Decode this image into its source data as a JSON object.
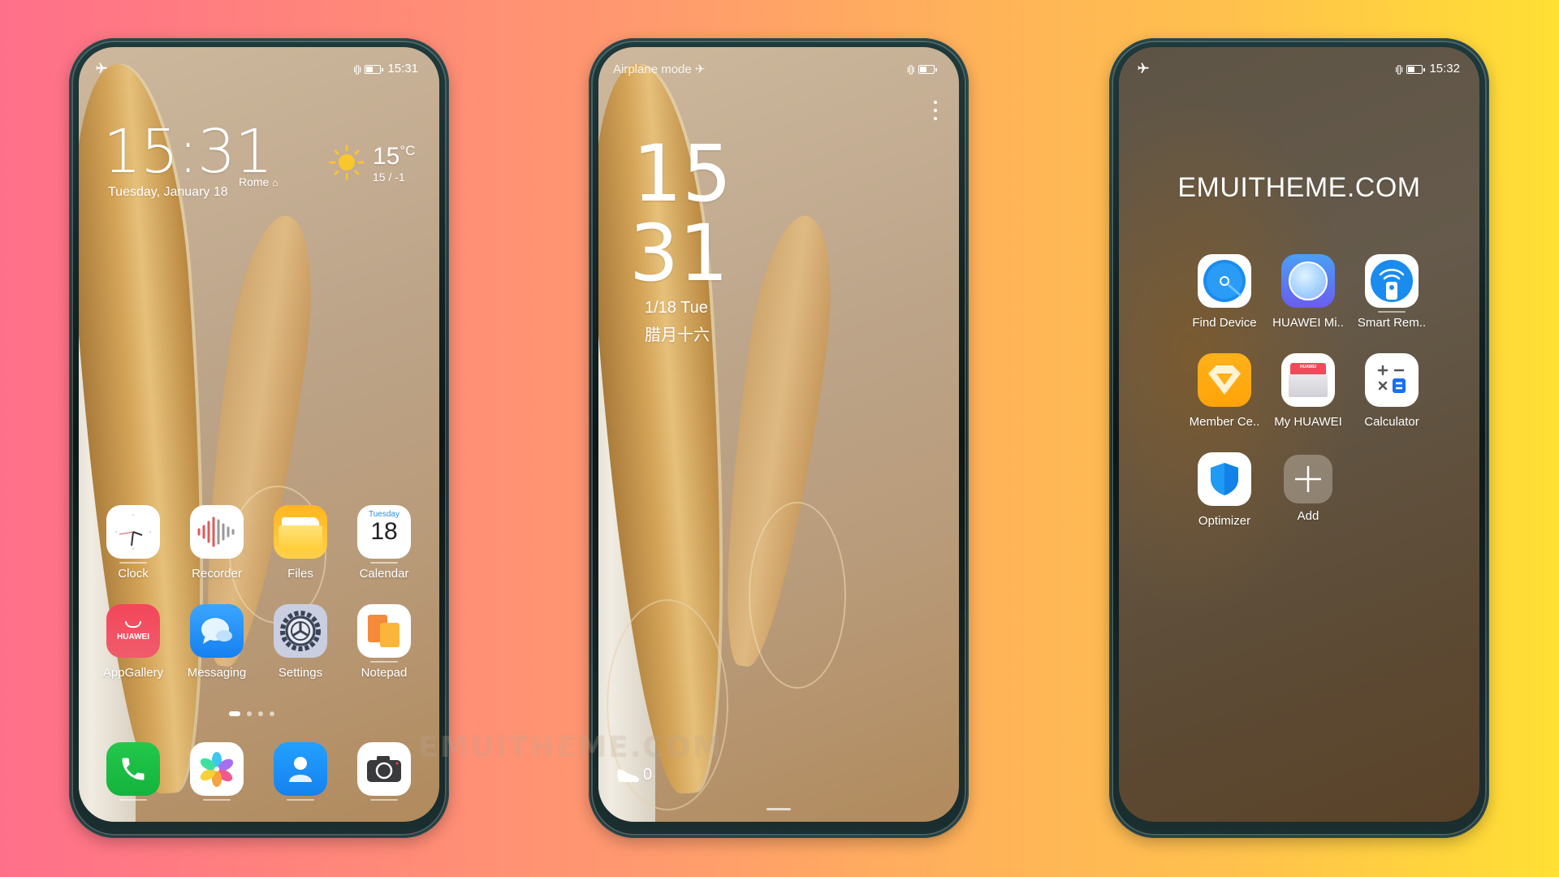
{
  "watermark": "EMUITHEME.COM",
  "phone_home": {
    "status_bar": {
      "left_icon": "airplane-icon",
      "time": "15:31"
    },
    "clock_widget": {
      "time": "15:31",
      "city": "Rome",
      "date": "Tuesday, January 18"
    },
    "weather_widget": {
      "icon": "sun-icon",
      "temperature": "15",
      "unit": "°C",
      "range": "15 / -1"
    },
    "apps": [
      {
        "label": "Clock",
        "icon": "clock-icon"
      },
      {
        "label": "Recorder",
        "icon": "recorder-icon"
      },
      {
        "label": "Files",
        "icon": "files-icon"
      },
      {
        "label": "Calendar",
        "icon": "calendar-icon",
        "weekday": "Tuesday",
        "day": "18"
      },
      {
        "label": "AppGallery",
        "icon": "appgallery-icon",
        "brand": "HUAWEI"
      },
      {
        "label": "Messaging",
        "icon": "messaging-icon"
      },
      {
        "label": "Settings",
        "icon": "settings-icon"
      },
      {
        "label": "Notepad",
        "icon": "notepad-icon"
      }
    ],
    "page_indicator": {
      "pages": 4,
      "current": 1
    },
    "dock": [
      {
        "name": "phone",
        "icon": "phone-icon"
      },
      {
        "name": "gallery",
        "icon": "gallery-icon"
      },
      {
        "name": "contacts",
        "icon": "contacts-icon"
      },
      {
        "name": "camera",
        "icon": "camera-icon"
      }
    ]
  },
  "phone_lock": {
    "status_bar": {
      "label": "Airplane mode"
    },
    "menu_icon": "more-vertical-icon",
    "clock": {
      "hours": "15",
      "minutes": "31"
    },
    "date": "1/18 Tue",
    "lunar_date": "腊月十六",
    "steps": {
      "icon": "shoe-icon",
      "count": "0"
    }
  },
  "phone_drawer": {
    "status_bar": {
      "left_icon": "airplane-icon",
      "time": "15:32"
    },
    "title": "EMUITHEME.COM",
    "apps": [
      {
        "label": "Find Device",
        "icon": "find-device-icon"
      },
      {
        "label": "HUAWEI Mi..",
        "icon": "huawei-mirror-icon"
      },
      {
        "label": "Smart Rem..",
        "icon": "smart-remote-icon"
      },
      {
        "label": "Member Ce..",
        "icon": "member-center-icon"
      },
      {
        "label": "My HUAWEI",
        "icon": "my-huawei-icon",
        "brand": "HUAWEI"
      },
      {
        "label": "Calculator",
        "icon": "calculator-icon"
      },
      {
        "label": "Optimizer",
        "icon": "optimizer-icon"
      },
      {
        "label": "Add",
        "icon": "add-icon"
      }
    ]
  },
  "colors": {
    "bg_left": "#ff6f8a",
    "bg_right": "#ffe033",
    "phone_frame": "#1f3a3c"
  }
}
